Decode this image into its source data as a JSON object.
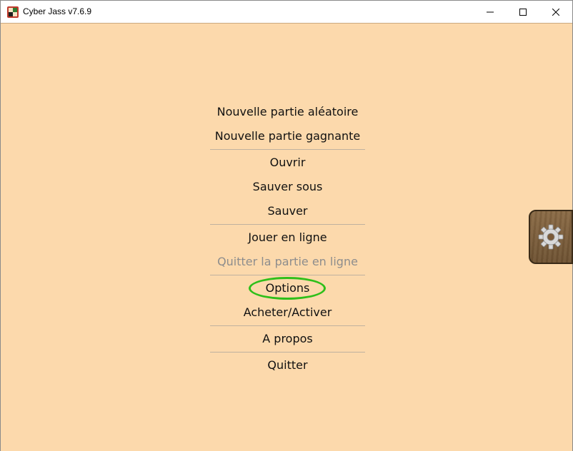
{
  "window": {
    "title": "Cyber Jass v7.6.9",
    "controls": [
      "minimize",
      "maximize",
      "close"
    ]
  },
  "menu": {
    "groups": [
      [
        {
          "label": "Nouvelle partie aléatoire",
          "enabled": true
        },
        {
          "label": "Nouvelle partie gagnante",
          "enabled": true
        }
      ],
      [
        {
          "label": "Ouvrir",
          "enabled": true
        },
        {
          "label": "Sauver sous",
          "enabled": true
        },
        {
          "label": "Sauver",
          "enabled": true
        }
      ],
      [
        {
          "label": "Jouer en ligne",
          "enabled": true
        },
        {
          "label": "Quitter la partie en ligne",
          "enabled": false
        }
      ],
      [
        {
          "label": "Options",
          "enabled": true,
          "highlighted": true
        },
        {
          "label": "Acheter/Activer",
          "enabled": true
        }
      ],
      [
        {
          "label": "A propos",
          "enabled": true
        }
      ],
      [
        {
          "label": "Quitter",
          "enabled": true
        }
      ]
    ]
  },
  "side_button": {
    "icon": "gear-icon"
  },
  "colors": {
    "background": "#fcd9ac",
    "highlight": "#2fbf1a",
    "disabled_text": "#8d8d8d"
  }
}
